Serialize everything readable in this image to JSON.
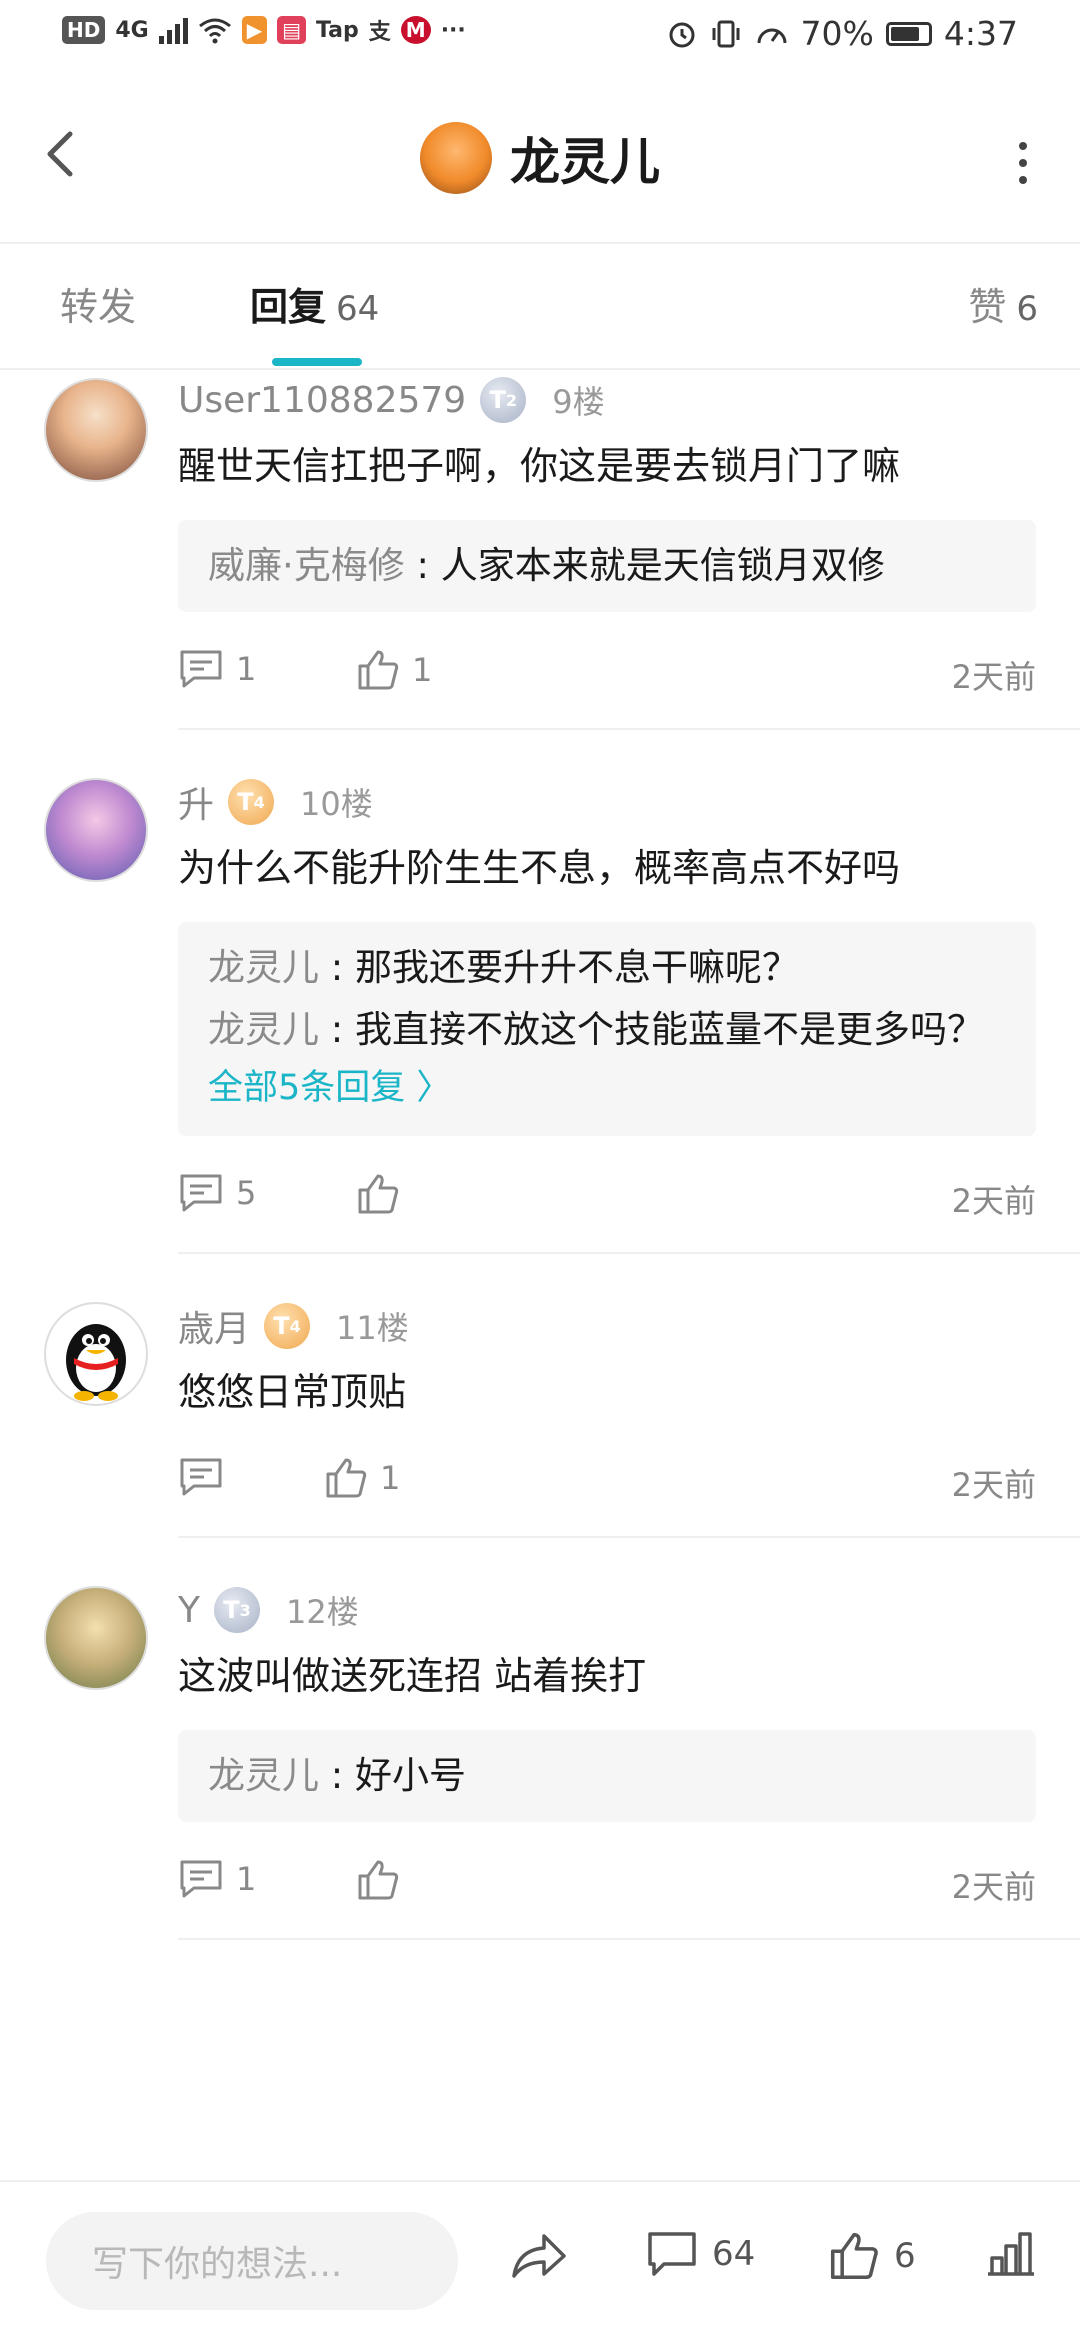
{
  "status_bar": {
    "left_chips": [
      "HD",
      "4G"
    ],
    "app_badges": [
      "Tap",
      "支"
    ],
    "more": "···",
    "battery_percent": "70%",
    "time": "4:37"
  },
  "header": {
    "title": "龙灵儿"
  },
  "tabs": [
    {
      "label": "转发",
      "count": ""
    },
    {
      "label": "回复",
      "count": "64"
    },
    {
      "label": "赞",
      "count": "6"
    }
  ],
  "posts": [
    {
      "user": "User110882579",
      "level": "2",
      "floor": "9楼",
      "text": "醒世天信扛把子啊，你这是要去锁月门了嘛",
      "replies": [
        {
          "name": "威廉·克梅修",
          "sep": " : ",
          "text": "人家本来就是天信锁月双修"
        }
      ],
      "all_replies": "",
      "comment_count": "1",
      "like_count": "1",
      "time": "2天前"
    },
    {
      "user": "升",
      "level": "4",
      "floor": "10楼",
      "text": "为什么不能升阶生生不息，概率高点不好吗",
      "replies": [
        {
          "name": "龙灵儿",
          "sep": " : ",
          "text": "那我还要升升不息干嘛呢？"
        },
        {
          "name": "龙灵儿",
          "sep": " : ",
          "text": "我直接不放这个技能蓝量不是更多吗？"
        }
      ],
      "all_replies": "全部5条回复 〉",
      "comment_count": "5",
      "like_count": "",
      "time": "2天前"
    },
    {
      "user": "歳月",
      "level": "4",
      "floor": "11楼",
      "text": "悠悠日常顶贴",
      "replies": [],
      "all_replies": "",
      "comment_count": "",
      "like_count": "1",
      "time": "2天前"
    },
    {
      "user": "Y",
      "level": "3",
      "floor": "12楼",
      "text": "这波叫做送死连招  站着挨打",
      "replies": [
        {
          "name": "龙灵儿",
          "sep": " : ",
          "text": "好小号"
        }
      ],
      "all_replies": "",
      "comment_count": "1",
      "like_count": "",
      "time": "2天前"
    }
  ],
  "bottom_bar": {
    "input_placeholder": "写下你的想法...",
    "comment_count": "64",
    "like_count": "6"
  },
  "colors": {
    "accent": "#1bb5c8",
    "muted_text": "#888888",
    "reply_bg": "#f6f6f6"
  }
}
